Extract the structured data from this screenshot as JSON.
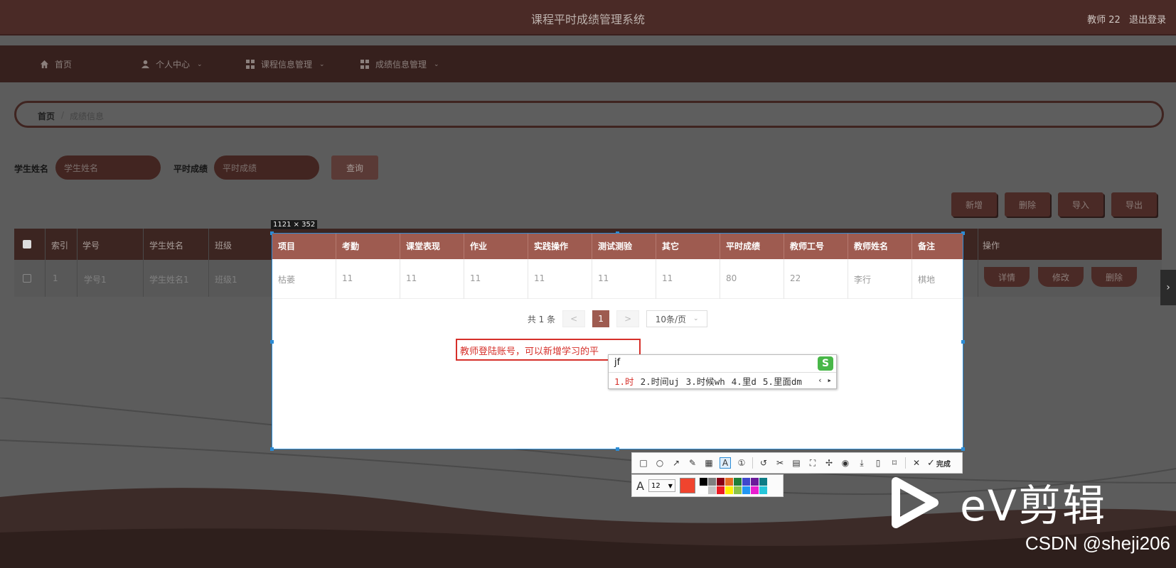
{
  "header": {
    "title": "课程平时成绩管理系统",
    "user": "教师 22",
    "logout": "退出登录"
  },
  "nav": {
    "items": [
      {
        "label": "首页",
        "icon": "home-icon"
      },
      {
        "label": "个人中心",
        "icon": "user-icon"
      },
      {
        "label": "课程信息管理",
        "icon": "grid-icon"
      },
      {
        "label": "成绩信息管理",
        "icon": "grid-icon"
      }
    ]
  },
  "breadcrumb": {
    "home": "首页",
    "separator": "/",
    "current": "成绩信息"
  },
  "search": {
    "name_label": "学生姓名",
    "name_placeholder": "学生姓名",
    "score_label": "平时成绩",
    "score_placeholder": "平时成绩",
    "query_button": "查询"
  },
  "actions": {
    "add": "新增",
    "delete": "删除",
    "import": "导入",
    "export": "导出"
  },
  "bg_table": {
    "headers": [
      "索引",
      "学号",
      "学生姓名",
      "班级",
      "操作"
    ],
    "row": [
      "1",
      "学号1",
      "学生姓名1",
      "班级1"
    ],
    "row_buttons": [
      "详情",
      "修改",
      "删除"
    ]
  },
  "capture": {
    "size_label": "1121 × 352",
    "headers": [
      "项目",
      "考勤",
      "课堂表现",
      "作业",
      "实践操作",
      "测试测验",
      "其它",
      "平时成绩",
      "教师工号",
      "教师姓名",
      "备注"
    ],
    "row": [
      "枯萎",
      "11",
      "11",
      "11",
      "11",
      "11",
      "11",
      "80",
      "22",
      "李行",
      "棋地"
    ],
    "pagination": {
      "total": "共 1 条",
      "prev": "<",
      "current": "1",
      "next": ">",
      "page_size": "10条/页"
    },
    "annotation_text": "教师登陆账号，可以新增学习的平"
  },
  "ime": {
    "input": "jf",
    "logo": "S",
    "candidates": [
      "1.时",
      "2.时间uj",
      "3.时候wh",
      "4.里d",
      "5.里面dm"
    ]
  },
  "annotate_toolbar": {
    "tools": [
      "rectangle-icon",
      "ellipse-icon",
      "arrow-icon",
      "pen-icon",
      "mosaic-icon",
      "text-icon",
      "number-icon",
      "undo-icon",
      "scissors-icon",
      "ocr-icon",
      "scan-icon",
      "pin-icon",
      "record-icon",
      "download-icon",
      "phone-icon",
      "bookmark-icon",
      "close-icon"
    ],
    "done": "完成",
    "font_size": "12",
    "current_color": "#f0442e",
    "palette": [
      "#000000",
      "#7f7f7f",
      "#880015",
      "#e46c24",
      "#1f7f3a",
      "#3f48cc",
      "#6a1b9a",
      "#0e7c86",
      "#ffffff",
      "#c3c3c3",
      "#ed1c24",
      "#fff200",
      "#8bc34a",
      "#2196f3",
      "#e91ecf",
      "#26c6da"
    ]
  },
  "watermark": {
    "ev_text": "eV剪辑",
    "csdn": "CSDN @sheji206"
  }
}
